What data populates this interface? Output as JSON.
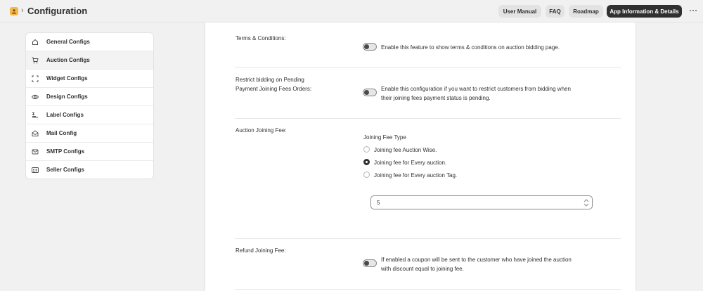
{
  "header": {
    "breadcrumb_sep": "›",
    "title": "Configuration",
    "buttons": {
      "user_manual": "User Manual",
      "faq": "FAQ",
      "roadmap": "Roadmap",
      "app_info": "App Information & Details"
    }
  },
  "sidebar": {
    "items": [
      {
        "label": "General Configs",
        "icon": "home-icon"
      },
      {
        "label": "Auction Configs",
        "icon": "cart-icon"
      },
      {
        "label": "Widget Configs",
        "icon": "widget-frame-icon"
      },
      {
        "label": "Design Configs",
        "icon": "eye-icon"
      },
      {
        "label": "Label Configs",
        "icon": "label-icon"
      },
      {
        "label": "Mail Config",
        "icon": "mail-icon"
      },
      {
        "label": "SMTP Configs",
        "icon": "email-icon"
      },
      {
        "label": "Seller Configs",
        "icon": "id-card-icon"
      }
    ],
    "active_index": 1
  },
  "main": {
    "terms": {
      "label": "Terms & Conditions:",
      "desc": "Enable this feature to show terms & conditions on auction bidding page."
    },
    "restrict": {
      "label_line1": "Restrict bidding on Pending",
      "label_line2": "Payment Joining Fees Orders:",
      "desc_line1": "Enable this configuration if you want to restrict customers from bidding when",
      "desc_line2": "their joining fees payment status is pending."
    },
    "joining_fee": {
      "label": "Auction Joining Fee:",
      "type_heading": "Joining Fee Type",
      "options": [
        "Joining fee Auction Wise.",
        "Joining fee for Every auction.",
        "Joining fee for Every auction Tag."
      ],
      "selected_index": 1,
      "amount": "5"
    },
    "refund": {
      "label": "Refund Joining Fee:",
      "desc_line1": "If enabled a coupon will be sent to the customer who have joined the auction",
      "desc_line2": "with discount equal to joining fee."
    }
  },
  "colors": {
    "accent_badge": "#f2b84b",
    "dark_button": "#303030",
    "background": "#f1f1f1"
  }
}
